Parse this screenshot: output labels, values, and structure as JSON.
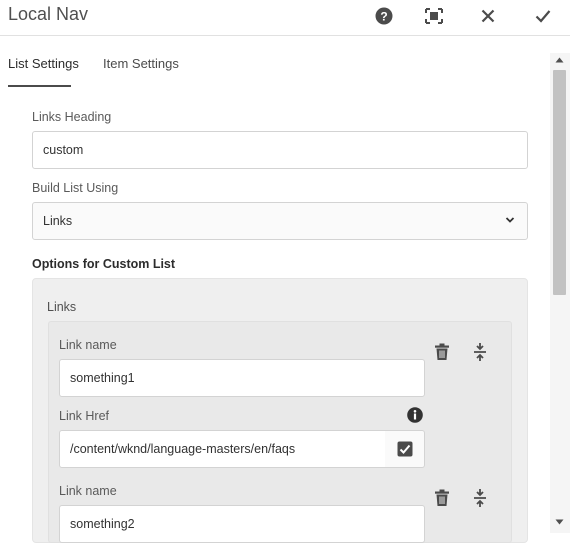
{
  "dialog": {
    "title": "Local Nav",
    "actions": [
      {
        "name": "help",
        "icon": "help-icon"
      },
      {
        "name": "fullscreen",
        "icon": "fullscreen-icon"
      },
      {
        "name": "cancel",
        "icon": "close-icon"
      },
      {
        "name": "done",
        "icon": "checkmark-icon"
      }
    ]
  },
  "tabs": [
    {
      "label": "List Settings",
      "active": true
    },
    {
      "label": "Item Settings",
      "active": false
    }
  ],
  "form": {
    "links_heading": {
      "label": "Links Heading",
      "value": "custom"
    },
    "build_list_using": {
      "label": "Build List Using",
      "value": "Links"
    },
    "custom_list_section": "Options for Custom List",
    "links_multifield": {
      "label": "Links",
      "items": [
        {
          "name_label": "Link name",
          "name_value": "something1",
          "href_label": "Link Href",
          "href_value": "/content/wknd/language-masters/en/faqs"
        },
        {
          "name_label": "Link name",
          "name_value": "something2"
        }
      ]
    }
  },
  "colors": {
    "icon": "#4b4b4b",
    "border": "#d3d3d3",
    "panel_bg": "#efefef"
  }
}
